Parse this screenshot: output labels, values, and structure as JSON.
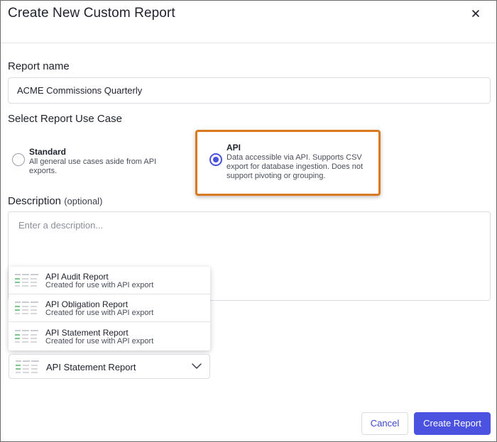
{
  "dialog": {
    "title": "Create New Custom Report"
  },
  "report_name": {
    "label": "Report name",
    "value": "ACME Commissions Quarterly"
  },
  "use_case": {
    "label": "Select Report Use Case",
    "options": [
      {
        "title": "Standard",
        "description_lines": [
          "All general use cases aside from API",
          "exports."
        ],
        "selected": false
      },
      {
        "title": "API",
        "description_lines": [
          "Data accessible via API. Supports CSV",
          "export for database ingestion. Does not",
          "support pivoting or grouping."
        ],
        "selected": true
      }
    ]
  },
  "description": {
    "label": "Description",
    "optional": "(optional)",
    "placeholder": "Enter a description..."
  },
  "template_menu": {
    "items": [
      {
        "title": "API Audit Report",
        "subtitle": "Created for use with API export"
      },
      {
        "title": "API Obligation Report",
        "subtitle": "Created for use with API export"
      },
      {
        "title": "API Statement Report",
        "subtitle": "Created for use with API export"
      }
    ],
    "selected_label": "API Statement Report",
    "icons": {
      "item": "report-template-icon",
      "chevron": "chevron-down-icon"
    }
  },
  "footer": {
    "cancel_label": "Cancel",
    "create_label": "Create Report"
  },
  "colors": {
    "primary": "#4b52e0",
    "highlight": "#d97a1e"
  }
}
